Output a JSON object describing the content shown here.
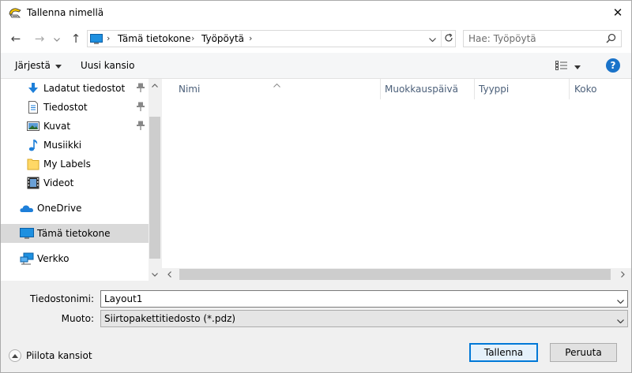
{
  "window": {
    "title": "Tallenna nimellä",
    "close_glyph": "✕"
  },
  "nav": {
    "back_glyph": "←",
    "forward_glyph": "→",
    "recent_glyph": "⌄",
    "up_glyph": "↑",
    "breadcrumbs": [
      "Tämä tietokone",
      "Työpöytä"
    ],
    "search_placeholder": "Hae: Työpöytä"
  },
  "toolbar": {
    "organize_label": "Järjestä",
    "new_folder_label": "Uusi kansio",
    "help_label": "?"
  },
  "sidebar": {
    "items": [
      {
        "label": "Ladatut tiedostot",
        "icon": "download-icon",
        "pinned": true
      },
      {
        "label": "Tiedostot",
        "icon": "documents-icon",
        "pinned": true
      },
      {
        "label": "Kuvat",
        "icon": "pictures-icon",
        "pinned": true
      },
      {
        "label": "Musiikki",
        "icon": "music-icon",
        "pinned": false
      },
      {
        "label": "My Labels",
        "icon": "folder-icon",
        "pinned": false
      },
      {
        "label": "Videot",
        "icon": "videos-icon",
        "pinned": false
      },
      {
        "label": "OneDrive",
        "icon": "onedrive-icon",
        "pinned": false
      },
      {
        "label": "Tämä tietokone",
        "icon": "computer-icon",
        "pinned": false,
        "selected": true
      },
      {
        "label": "Verkko",
        "icon": "network-icon",
        "pinned": false
      }
    ]
  },
  "filelist": {
    "columns": [
      "Nimi",
      "Muokkauspäivä",
      "Tyyppi",
      "Koko"
    ]
  },
  "form": {
    "filename_label": "Tiedostonimi:",
    "filename_value": "Layout1",
    "filetype_label": "Muoto:",
    "filetype_value": "Siirtopakettitiedosto (*.pdz)"
  },
  "footer": {
    "hide_folders_label": "Piilota kansiot",
    "save_label": "Tallenna",
    "cancel_label": "Peruuta"
  },
  "colors": {
    "accent": "#0078d7",
    "selection": "#d9d9d9",
    "column_header_text": "#4c607a"
  }
}
